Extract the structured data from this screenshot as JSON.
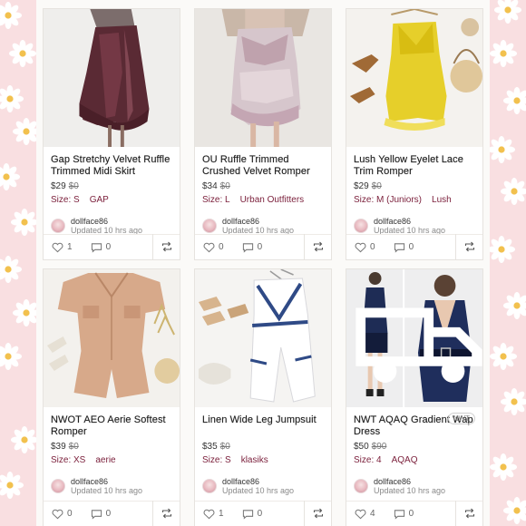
{
  "colors": {
    "background_pink": "#f9dfe1",
    "accent_maroon": "#7a1e3a",
    "text_dark": "#1f1f1f",
    "text_muted": "#8a8a8a"
  },
  "icons": {
    "like": "heart-icon",
    "comment": "comment-icon",
    "share": "share-icon"
  },
  "listings": [
    {
      "title": "Gap Stretchy Velvet Ruffle Trimmed Midi Skirt",
      "price": "$29",
      "original_price": "$0",
      "size_label": "Size: S",
      "brand": "GAP",
      "seller": "dollface86",
      "updated": "Updated 10 hrs ago",
      "likes": "1",
      "comments": "0",
      "badge": "",
      "photo": "velvet-skirt"
    },
    {
      "title": "OU Ruffle Trimmed Crushed Velvet Romper",
      "price": "$34",
      "original_price": "$0",
      "size_label": "Size: L",
      "brand": "Urban Outfitters",
      "seller": "dollface86",
      "updated": "Updated 10 hrs ago",
      "likes": "0",
      "comments": "0",
      "badge": "",
      "photo": "velvet-romper"
    },
    {
      "title": "Lush Yellow Eyelet Lace Trim Romper",
      "price": "$29",
      "original_price": "$0",
      "size_label": "Size: M (Juniors)",
      "brand": "Lush",
      "seller": "dollface86",
      "updated": "Updated 10 hrs ago",
      "likes": "0",
      "comments": "0",
      "badge": "",
      "photo": "yellow-romper"
    },
    {
      "title": "NWOT AEO Aerie Softest Romper",
      "price": "$39",
      "original_price": "$0",
      "size_label": "Size: XS",
      "brand": "aerie",
      "seller": "dollface86",
      "updated": "Updated 10 hrs ago",
      "likes": "0",
      "comments": "0",
      "badge": "",
      "photo": "tan-romper"
    },
    {
      "title": "Linen Wide Leg Jumpsuit",
      "price": "$35",
      "original_price": "$0",
      "size_label": "Size: S",
      "brand": "klasiks",
      "seller": "dollface86",
      "updated": "Updated 10 hrs ago",
      "likes": "1",
      "comments": "0",
      "badge": "",
      "photo": "linen-jumpsuit"
    },
    {
      "title": "NWT AQAQ Gradient Wap Dress",
      "price": "$50",
      "original_price": "$90",
      "size_label": "Size: 4",
      "brand": "AQAQ",
      "seller": "dollface86",
      "updated": "Updated 10 hrs ago",
      "likes": "4",
      "comments": "0",
      "badge": "NWT",
      "photo": "navy-wrap-dress"
    }
  ]
}
